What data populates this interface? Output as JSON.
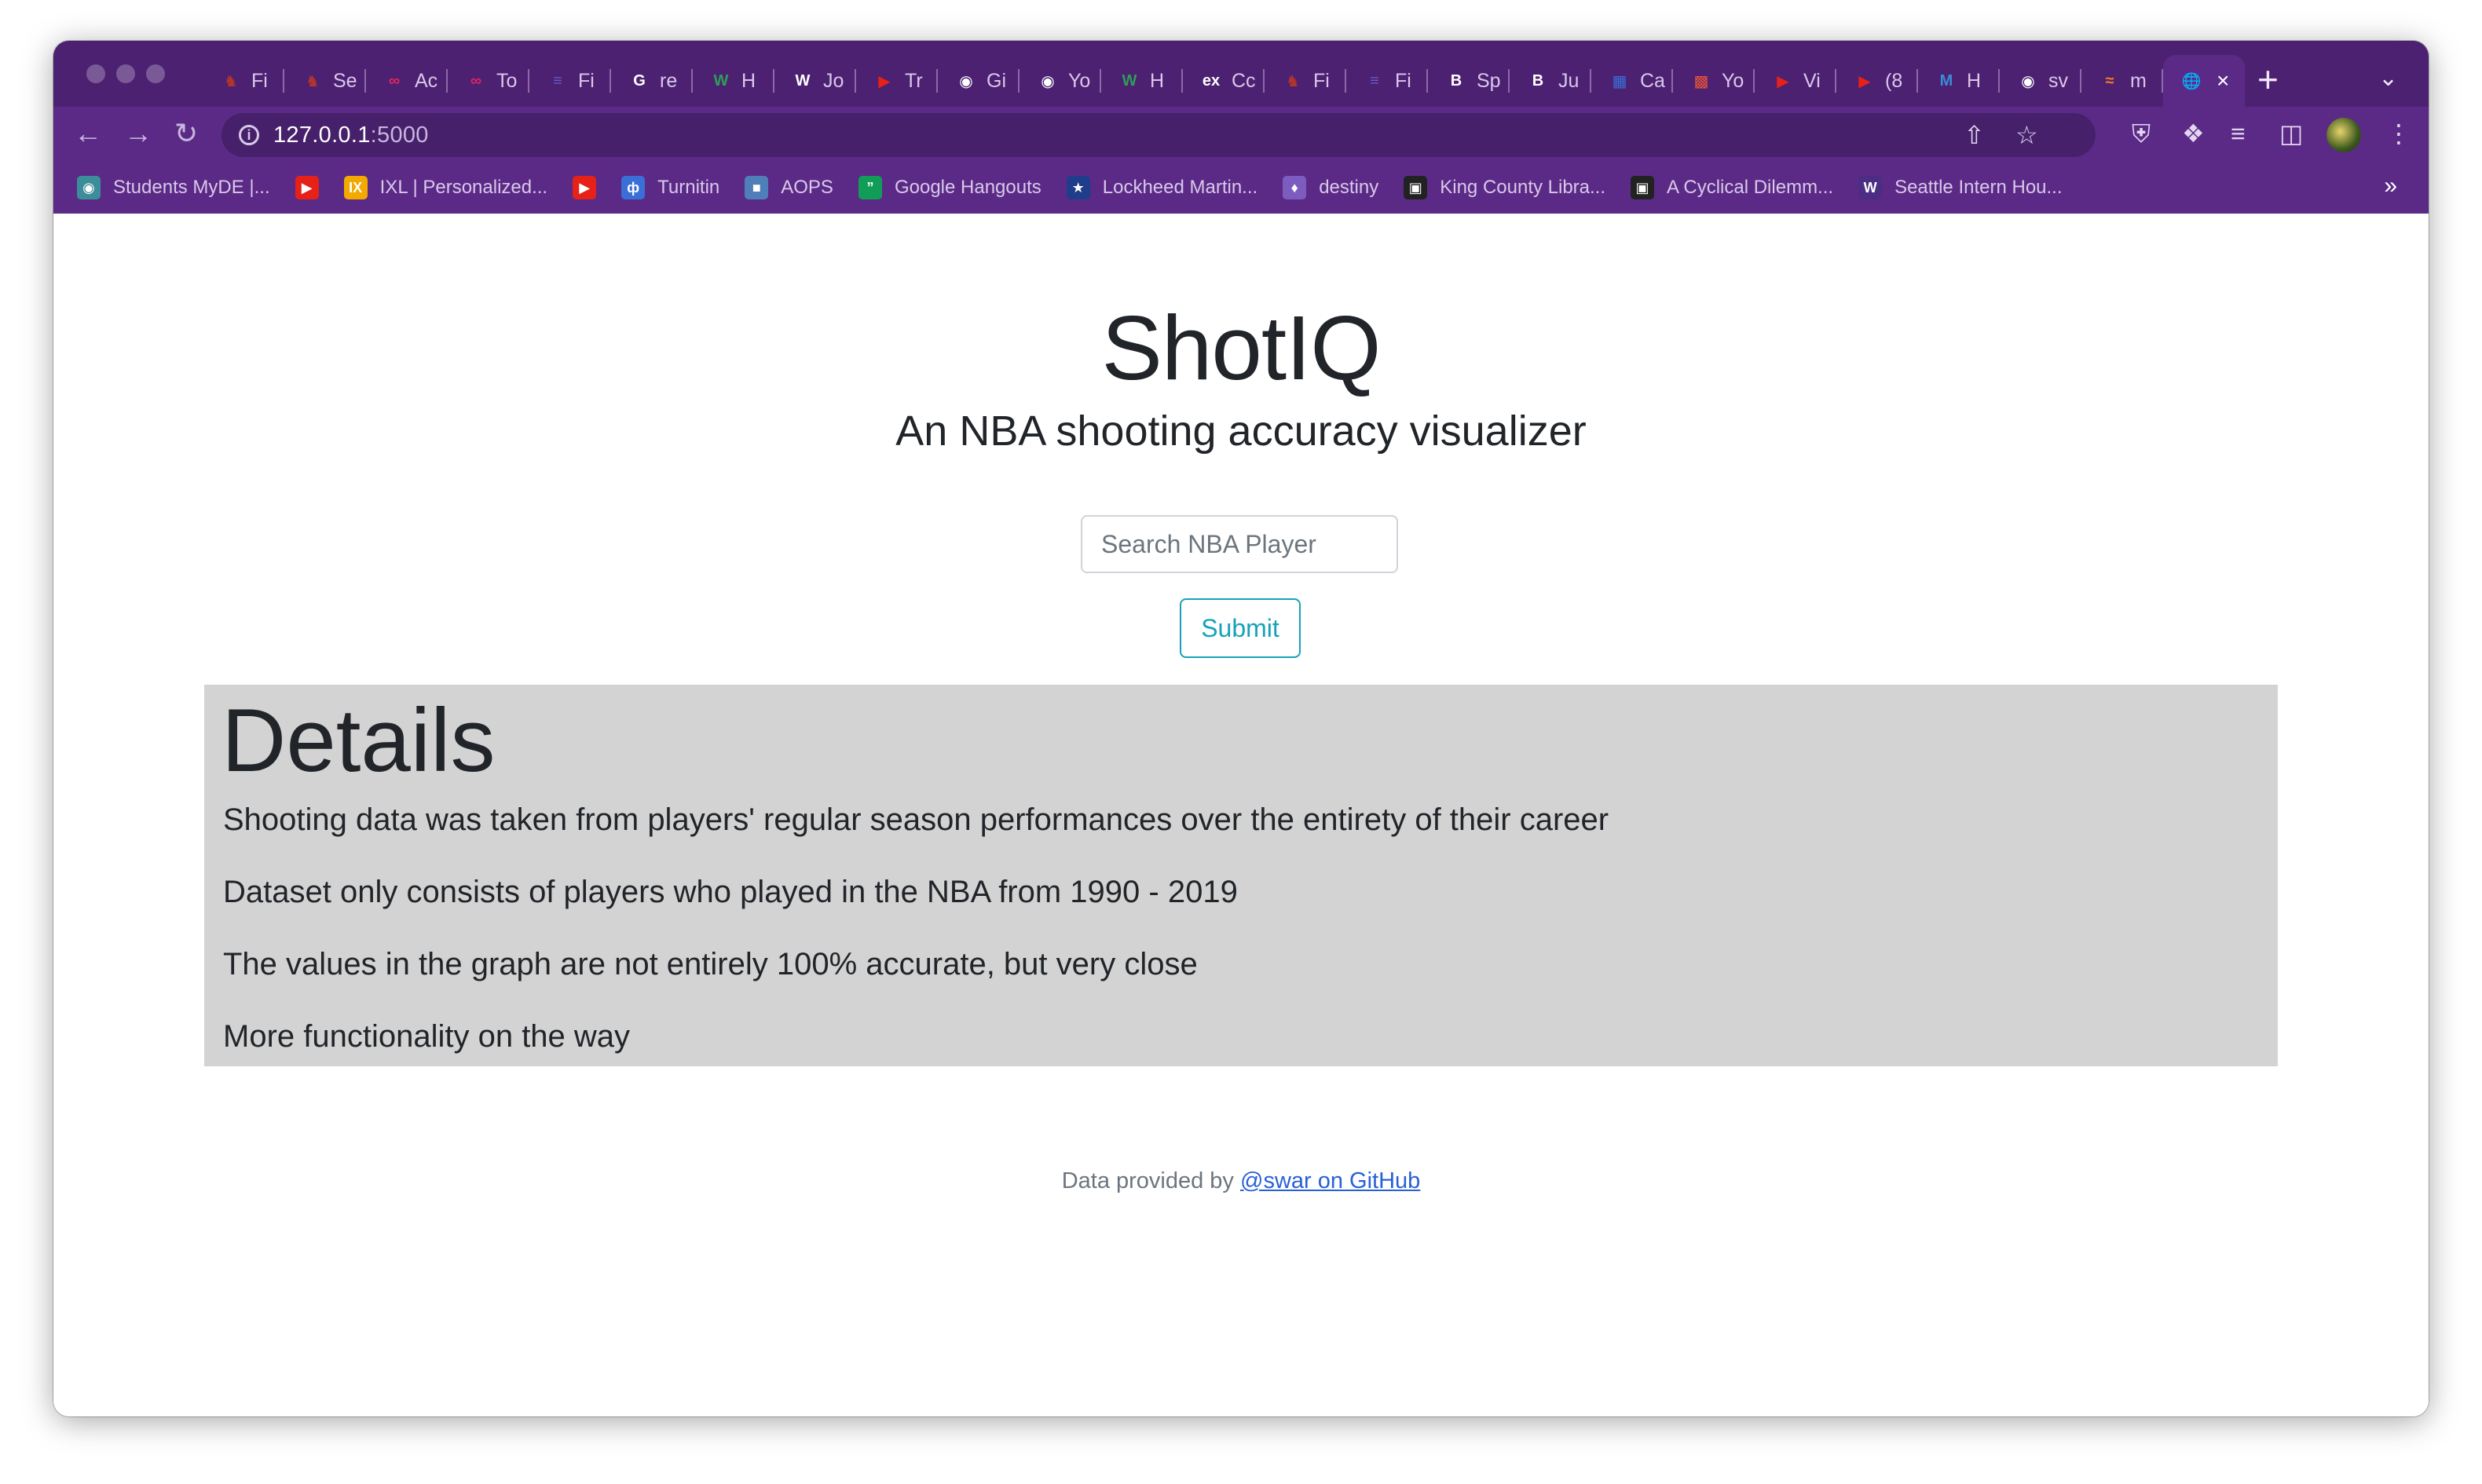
{
  "browser": {
    "tabs": [
      {
        "title": "Fi",
        "icon": "harvard-icon",
        "color": "#b5352b"
      },
      {
        "title": "Se",
        "icon": "harvard-icon",
        "color": "#b5352b"
      },
      {
        "title": "Ac",
        "icon": "loop-icon",
        "color": "#e0245e"
      },
      {
        "title": "To",
        "icon": "loop-icon",
        "color": "#e0245e"
      },
      {
        "title": "Fi",
        "icon": "list-icon",
        "color": "#6a5acd"
      },
      {
        "title": "re",
        "icon": "google-icon",
        "color": "#ffffff"
      },
      {
        "title": "H",
        "icon": "w-icon",
        "color": "#2e9d5b"
      },
      {
        "title": "Jo",
        "icon": "wikipedia-icon",
        "color": "#ffffff"
      },
      {
        "title": "Tr",
        "icon": "youtube-icon",
        "color": "#e62117"
      },
      {
        "title": "Gi",
        "icon": "github-icon",
        "color": "#ffffff"
      },
      {
        "title": "Yo",
        "icon": "github-icon",
        "color": "#ffffff"
      },
      {
        "title": "H",
        "icon": "w-icon",
        "color": "#2e9d5b"
      },
      {
        "title": "Cc",
        "icon": "edx-icon",
        "color": "#ffffff"
      },
      {
        "title": "Fi",
        "icon": "harvard-icon",
        "color": "#b5352b"
      },
      {
        "title": "Fi",
        "icon": "list-icon",
        "color": "#6a5acd"
      },
      {
        "title": "Sp",
        "icon": "bold-b-icon",
        "color": "#ffffff"
      },
      {
        "title": "Ju",
        "icon": "bold-b-icon",
        "color": "#ffffff"
      },
      {
        "title": "Ca",
        "icon": "calendar-icon",
        "color": "#3b6fd8"
      },
      {
        "title": "Yo",
        "icon": "image-icon",
        "color": "#e8533a"
      },
      {
        "title": "Vi",
        "icon": "youtube-icon",
        "color": "#e62117"
      },
      {
        "title": "(8",
        "icon": "youtube-icon",
        "color": "#e62117"
      },
      {
        "title": "H",
        "icon": "m-icon",
        "color": "#3a8bd8"
      },
      {
        "title": "sv",
        "icon": "github-icon",
        "color": "#ffffff"
      },
      {
        "title": "m",
        "icon": "stack-icon",
        "color": "#f48024"
      }
    ],
    "active_tab_icon": "globe-icon",
    "url_host": "127.0.0.1",
    "url_port": ":5000",
    "bookmarks": [
      {
        "label": "Students MyDE |...",
        "icon": "globe-icon",
        "color": "#3b8d99"
      },
      {
        "label": "",
        "icon": "youtube-icon",
        "color": "#e62117"
      },
      {
        "label": "IXL | Personalized...",
        "icon": "ixl-icon",
        "color": "#f2a900"
      },
      {
        "label": "",
        "icon": "youtube-icon",
        "color": "#e62117"
      },
      {
        "label": "Turnitin",
        "icon": "turnitin-icon",
        "color": "#3a6fd8"
      },
      {
        "label": "AOPS",
        "icon": "cube-icon",
        "color": "#4f7fb8"
      },
      {
        "label": "Google Hangouts",
        "icon": "hangouts-icon",
        "color": "#0f9d58"
      },
      {
        "label": "Lockheed Martin...",
        "icon": "star-icon",
        "color": "#1f3d8a"
      },
      {
        "label": "destiny",
        "icon": "flame-icon",
        "color": "#7d5cc0"
      },
      {
        "label": "King County Libra...",
        "icon": "library-icon",
        "color": "#222222"
      },
      {
        "label": "A Cyclical Dilemm...",
        "icon": "photo-icon",
        "color": "#222222"
      },
      {
        "label": "Seattle Intern Hou...",
        "icon": "uw-icon",
        "color": "#4b2e83"
      }
    ]
  },
  "page": {
    "title": "ShotIQ",
    "subtitle": "An NBA shooting accuracy visualizer",
    "search_placeholder": "Search NBA Player",
    "submit_label": "Submit",
    "details": {
      "heading": "Details",
      "lines": [
        "Shooting data was taken from players' regular season performances over the entirety of their career",
        "Dataset only consists of players who played in the NBA from 1990 - 2019",
        "The values in the graph are not entirely 100% accurate, but very close",
        "More functionality on the way"
      ]
    },
    "footer": {
      "prefix": "Data provided by ",
      "link": "@swar on GitHub"
    }
  }
}
